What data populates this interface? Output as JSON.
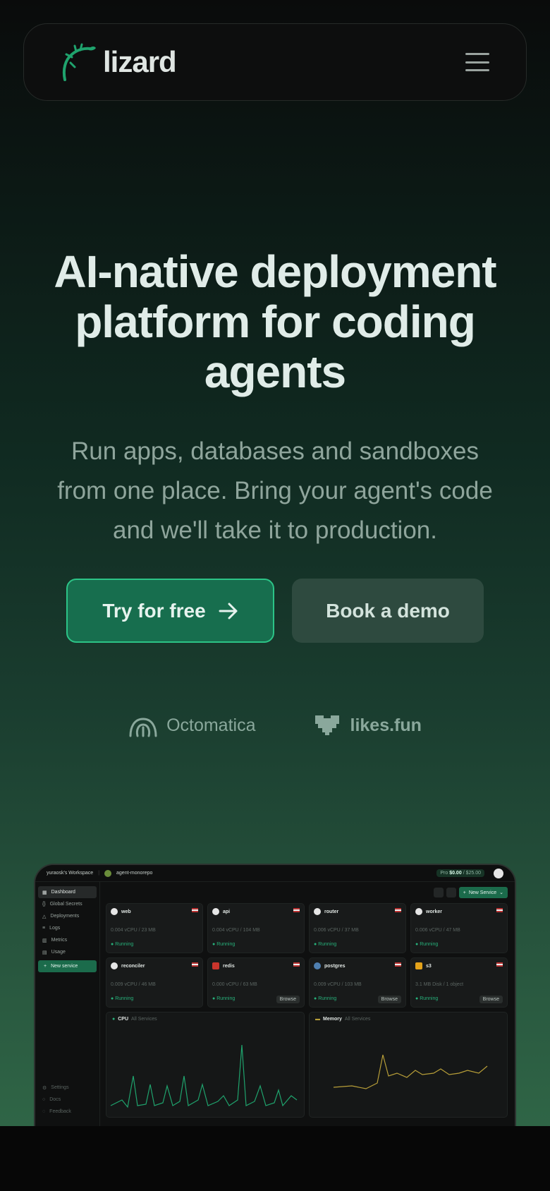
{
  "brand": {
    "name": "lizard",
    "accent": "#1b6b4b"
  },
  "nav": {
    "menu_icon": "hamburger-icon"
  },
  "hero": {
    "title": "AI-native deployment platform for coding agents",
    "subtitle": "Run apps, databases and sandboxes from one place. Bring your agent's code and we'll take it to production."
  },
  "cta": {
    "primary_label": "Try for free",
    "primary_icon": "arrow-right-icon",
    "secondary_label": "Book a demo"
  },
  "partners": [
    {
      "name": "Octomatica"
    },
    {
      "name": "likes.fun"
    }
  ],
  "dashboard": {
    "workspace": "yuraosk's Workspace",
    "project": "agent-monorepo",
    "plan_tier": "Pro",
    "plan_spend": "$0.00",
    "plan_limit": "/ $25.00",
    "sidebar": [
      "Dashboard",
      "Global Secrets",
      "Deployments",
      "Logs",
      "Metrics",
      "Usage"
    ],
    "new_service_label": "New service",
    "sidebar_bottom": [
      "Settings",
      "Docs",
      "Feedback"
    ],
    "new_service_button": "New Service",
    "services": [
      {
        "name": "web",
        "usage": "0.004 vCPU  /  23 MB",
        "status": "Running",
        "icon": "github-icon"
      },
      {
        "name": "api",
        "usage": "0.004 vCPU  /  104 MB",
        "status": "Running",
        "icon": "github-icon"
      },
      {
        "name": "router",
        "usage": "0.006 vCPU  /  37 MB",
        "status": "Running",
        "icon": "github-icon"
      },
      {
        "name": "worker",
        "usage": "0.006 vCPU  /  47 MB",
        "status": "Running",
        "icon": "github-icon"
      },
      {
        "name": "reconciler",
        "usage": "0.009 vCPU  /  46 MB",
        "status": "Running",
        "icon": "github-icon"
      },
      {
        "name": "redis",
        "usage": "0.000 vCPU  /  63 MB",
        "status": "Running",
        "icon": "redis-icon",
        "action": "Browse"
      },
      {
        "name": "postgres",
        "usage": "0.009 vCPU  /  103 MB",
        "status": "Running",
        "icon": "postgres-icon",
        "action": "Browse"
      },
      {
        "name": "s3",
        "usage": "3.1 MB Disk  /  1 object",
        "status": "Running",
        "icon": "bucket-icon",
        "action": "Browse"
      }
    ],
    "cpu_chart": {
      "title": "CPU",
      "scope": "All Services"
    },
    "memory_chart": {
      "title": "Memory",
      "scope": "All Services"
    }
  }
}
